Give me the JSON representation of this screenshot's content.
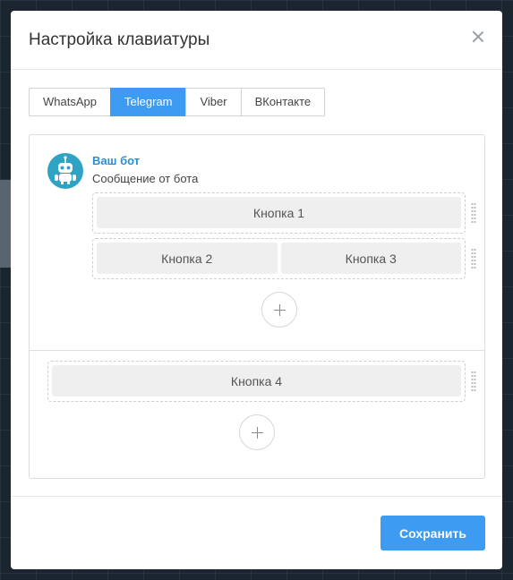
{
  "modal": {
    "title": "Настройка клавиатуры"
  },
  "tabs": [
    {
      "label": "WhatsApp",
      "active": false
    },
    {
      "label": "Telegram",
      "active": true
    },
    {
      "label": "Viber",
      "active": false
    },
    {
      "label": "ВКонтакте",
      "active": false
    }
  ],
  "bot": {
    "name": "Ваш бот",
    "message": "Сообщение от бота",
    "avatar_icon": "robot-icon"
  },
  "inline_keyboard": {
    "rows": [
      [
        "Кнопка 1"
      ],
      [
        "Кнопка 2",
        "Кнопка 3"
      ]
    ]
  },
  "reply_keyboard": {
    "rows": [
      [
        "Кнопка 4"
      ]
    ]
  },
  "footer": {
    "save_label": "Сохранить"
  },
  "colors": {
    "accent": "#3d9bf2",
    "avatar": "#2fa3c4",
    "bot_name": "#2a8fd0"
  }
}
